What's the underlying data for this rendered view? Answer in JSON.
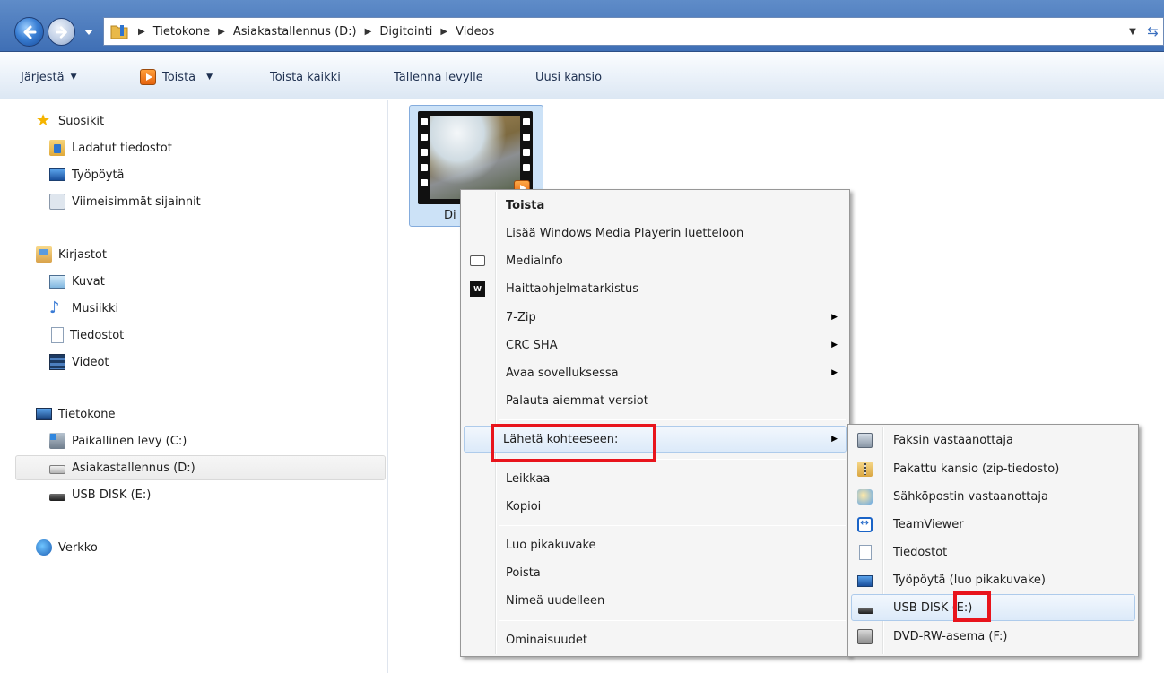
{
  "address_bar": {
    "breadcrumbs": [
      "Tietokone",
      "Asiakastallennus (D:)",
      "Digitointi",
      "Videos"
    ]
  },
  "toolbar": {
    "organize": "Järjestä",
    "play": "Toista",
    "play_all": "Toista kaikki",
    "burn": "Tallenna levylle",
    "new_folder": "Uusi kansio"
  },
  "nav": {
    "favorites": "Suosikit",
    "downloads": "Ladatut tiedostot",
    "desktop": "Työpöytä",
    "recent": "Viimeisimmät sijainnit",
    "libraries": "Kirjastot",
    "pictures": "Kuvat",
    "music": "Musiikki",
    "documents": "Tiedostot",
    "videos": "Videot",
    "computer": "Tietokone",
    "drive_c": "Paikallinen levy (C:)",
    "drive_d": "Asiakastallennus (D:)",
    "drive_e": "USB DISK (E:)",
    "network": "Verkko"
  },
  "file": {
    "name_visible": "Di"
  },
  "context_menu": {
    "items": [
      "Toista",
      "Lisää Windows Media Playerin luetteloon",
      "MediaInfo",
      "Haittaohjelmatarkistus",
      "7-Zip",
      "CRC SHA",
      "Avaa sovelluksessa",
      "Palauta aiemmat versiot",
      "Lähetä kohteeseen:",
      "Leikkaa",
      "Kopioi",
      "Luo pikakuvake",
      "Poista",
      "Nimeä uudelleen",
      "Ominaisuudet"
    ]
  },
  "sendto_menu": {
    "items": [
      "Faksin vastaanottaja",
      "Pakattu kansio (zip-tiedosto)",
      "Sähköpostin vastaanottaja",
      "TeamViewer",
      "Tiedostot",
      "Työpöytä (luo pikakuvake)",
      "USB DISK (E:)",
      "DVD-RW-asema (F:)"
    ]
  },
  "colors": {
    "annotation": "#e8141c",
    "selection": "#cce2f7",
    "titlebar": "#3f6fb5"
  }
}
